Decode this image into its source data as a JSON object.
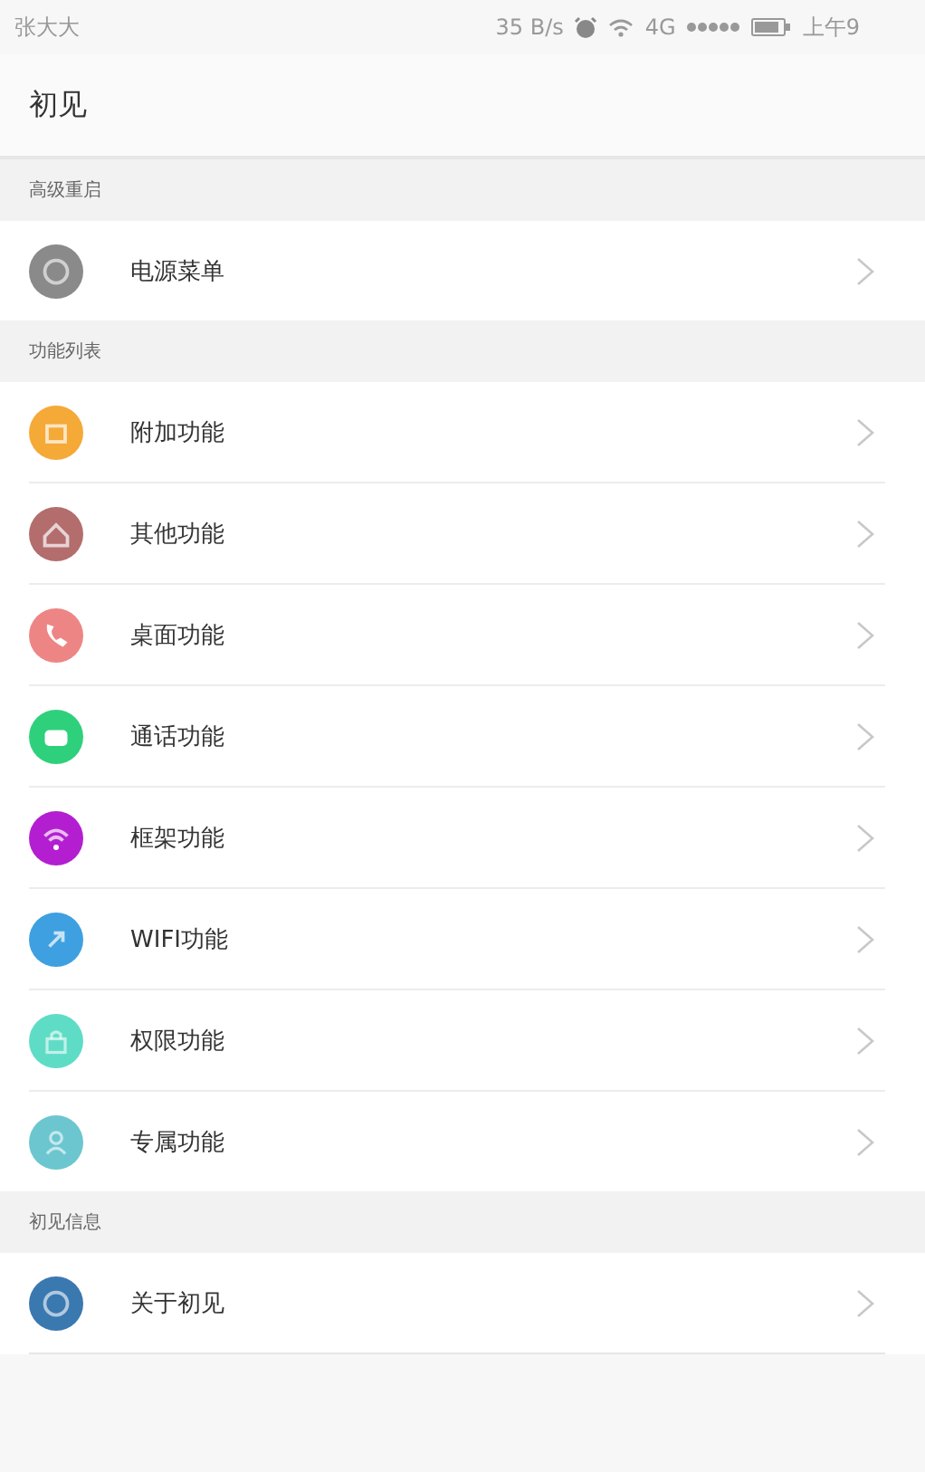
{
  "status_bar": {
    "carrier": "张大大",
    "speed": "35 B/s",
    "network": "4G",
    "time": "上午9"
  },
  "header": {
    "title": "初见"
  },
  "sections": [
    {
      "title": "高级重启",
      "items": [
        {
          "label": "电源菜单",
          "color": "#8a8a8a"
        }
      ]
    },
    {
      "title": "功能列表",
      "items": [
        {
          "label": "附加功能",
          "color": "#f5a937"
        },
        {
          "label": "其他功能",
          "color": "#b36d6d"
        },
        {
          "label": "桌面功能",
          "color": "#ee8585"
        },
        {
          "label": "通话功能",
          "color": "#2fd07c"
        },
        {
          "label": "框架功能",
          "color": "#b31fd0"
        },
        {
          "label": "WIFI功能",
          "color": "#3ea0e0"
        },
        {
          "label": "权限功能",
          "color": "#5fdcc6"
        },
        {
          "label": "专属功能",
          "color": "#6cc6cf"
        }
      ]
    },
    {
      "title": "初见信息",
      "items": [
        {
          "label": "关于初见",
          "color": "#3a78b0"
        }
      ]
    }
  ]
}
